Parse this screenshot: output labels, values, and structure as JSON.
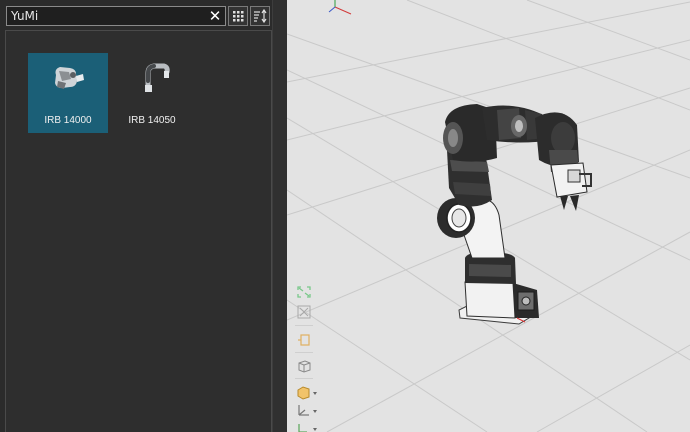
{
  "search": {
    "value": "YuMi",
    "clear_symbol": "✕"
  },
  "library": {
    "items": [
      {
        "label": "IRB 14000",
        "selected": true
      },
      {
        "label": "IRB 14050",
        "selected": false
      }
    ]
  },
  "colors": {
    "selection": "#1b5f77",
    "viewport_bg": "#e3e3e3",
    "panel_bg": "#2b2b2b"
  },
  "viewport_tools": [
    "zoom-extents-icon",
    "zoom-window-icon",
    "view-center-icon",
    "view-cube-icon",
    "box-view-icon",
    "axis-view-icon",
    "frame-icon"
  ]
}
